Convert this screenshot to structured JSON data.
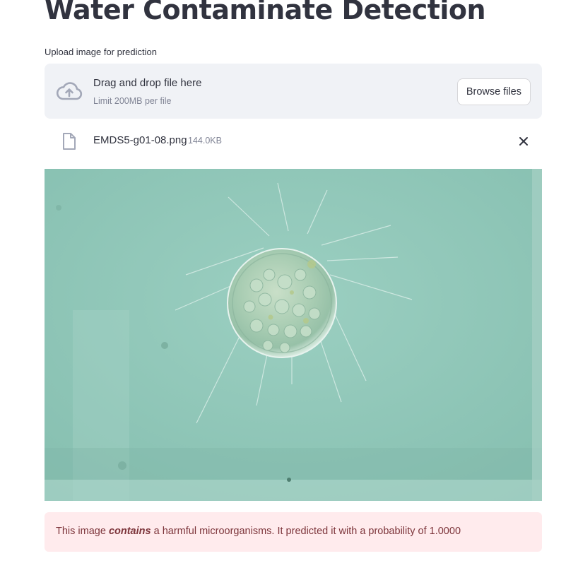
{
  "page": {
    "title": "Water Contaminate Detection"
  },
  "uploader": {
    "label": "Upload image for prediction",
    "dropzone_title": "Drag and drop file here",
    "dropzone_limit": "Limit 200MB per file",
    "browse_label": "Browse files",
    "icon": "cloud-upload-icon"
  },
  "uploaded_file": {
    "name": "EMDS5-g01-08.png",
    "size": "144.0KB",
    "icon": "file-icon",
    "remove_icon": "close-icon"
  },
  "result": {
    "prefix": "This image ",
    "emphasis": "contains",
    "suffix": " a harmful microorganisms. It predicted it with a probability of 1.0000"
  },
  "colors": {
    "dropzone_bg": "#f0f2f6",
    "alert_bg": "#ffebed",
    "alert_text": "#7d353b",
    "micrograph_bg": "#8ec5b7"
  }
}
